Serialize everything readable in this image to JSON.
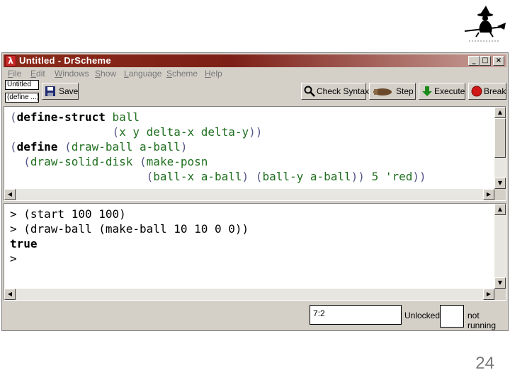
{
  "window": {
    "title": "Untitled - DrScheme",
    "app_icon_glyph": "λ"
  },
  "menubar": [
    {
      "key": "F",
      "rest": "ile"
    },
    {
      "key": "E",
      "rest": "dit"
    },
    {
      "key": "W",
      "rest": "indows"
    },
    {
      "key": "S",
      "rest": "how"
    },
    {
      "key": "L",
      "rest": "anguage"
    },
    {
      "key": "S",
      "rest": "cheme"
    },
    {
      "key": "H",
      "rest": "elp"
    }
  ],
  "toolbar": {
    "filename_label": "Untitled",
    "define_menu_label": "(define ...)",
    "save_label": "Save",
    "check_syntax_label": "Check Syntax",
    "step_label": "Step",
    "execute_label": "Execute",
    "break_label": "Break"
  },
  "definitions_code": [
    [
      {
        "t": "(",
        "c": "pr"
      },
      {
        "t": "define-struct",
        "c": "kw"
      },
      {
        "t": " ",
        "c": ""
      },
      {
        "t": "ball",
        "c": "id"
      }
    ],
    [
      {
        "t": "               ",
        "c": ""
      },
      {
        "t": "(",
        "c": "pr"
      },
      {
        "t": "x y delta-x delta-y",
        "c": "id"
      },
      {
        "t": "))",
        "c": "pr"
      }
    ],
    [
      {
        "t": "(",
        "c": "pr"
      },
      {
        "t": "define",
        "c": "kw"
      },
      {
        "t": " ",
        "c": ""
      },
      {
        "t": "(",
        "c": "pr"
      },
      {
        "t": "draw-ball a-ball",
        "c": "id"
      },
      {
        "t": ")",
        "c": "pr"
      }
    ],
    [
      {
        "t": "  ",
        "c": ""
      },
      {
        "t": "(",
        "c": "pr"
      },
      {
        "t": "draw-solid-disk ",
        "c": "id"
      },
      {
        "t": "(",
        "c": "pr"
      },
      {
        "t": "make-posn",
        "c": "id"
      }
    ],
    [
      {
        "t": "                    ",
        "c": ""
      },
      {
        "t": "(",
        "c": "pr"
      },
      {
        "t": "ball-x a-ball",
        "c": "id"
      },
      {
        "t": ") (",
        "c": "pr"
      },
      {
        "t": "ball-y a-ball",
        "c": "id"
      },
      {
        "t": ")) ",
        "c": "pr"
      },
      {
        "t": "5",
        "c": "num"
      },
      {
        "t": " ",
        "c": ""
      },
      {
        "t": "'red",
        "c": "sym"
      },
      {
        "t": "))",
        "c": "pr"
      }
    ]
  ],
  "interactions_code": [
    [
      {
        "t": "> (start 100 100)",
        "c": ""
      }
    ],
    [
      {
        "t": "> (draw-ball (make-ball 10 10 0 0))",
        "c": ""
      }
    ],
    [
      {
        "t": "true",
        "c": "kw"
      }
    ],
    [
      {
        "t": ">",
        "c": ""
      }
    ]
  ],
  "status": {
    "position": "7:2",
    "lock_state": "Unlocked",
    "running_state": "not running"
  },
  "slide": {
    "page_number": "24"
  }
}
